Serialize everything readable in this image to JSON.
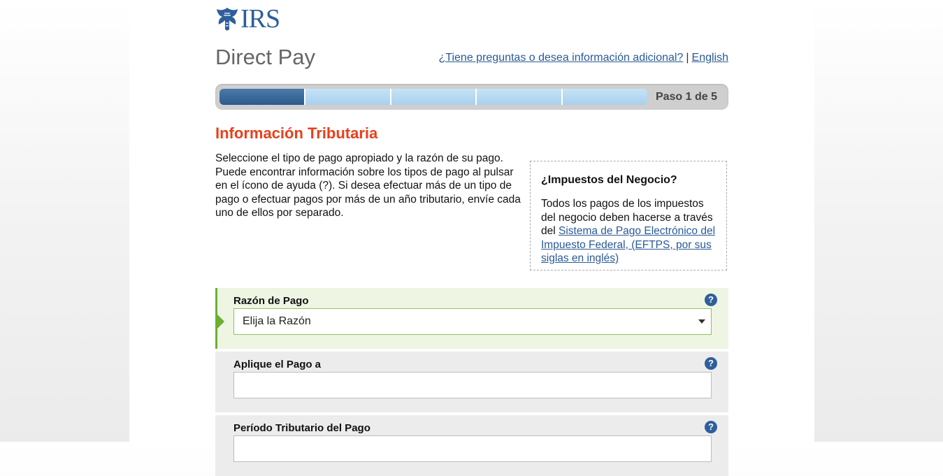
{
  "logo": {
    "text": "IRS"
  },
  "app": {
    "title": "Direct Pay"
  },
  "header": {
    "questions_link": "¿Tiene preguntas o desea información adicional?",
    "separator": "|",
    "language_link": "English"
  },
  "progress": {
    "label": "Paso 1 de 5",
    "current_step": 1,
    "total_steps": 5
  },
  "section": {
    "heading": "Información Tributaria",
    "intro": "Seleccione el tipo de pago apropiado y la razón de su pago. Puede encontrar información sobre los tipos de pago al pulsar en el ícono de ayuda (?). Si desea efectuar más de un tipo de pago o efectuar pagos por más de un año tributario, envíe cada uno de ellos por separado."
  },
  "business_box": {
    "heading": "¿Impuestos del Negocio?",
    "text_before": "Todos los pagos de los impuestos del negocio deben hacerse a través del ",
    "link": "Sistema de Pago Electrónico del Impuesto Federal, (EFTPS, por sus siglas en inglés)"
  },
  "form": {
    "help_icon": "?",
    "reason": {
      "label": "Razón de Pago",
      "value": "Elija la Razón"
    },
    "apply_to": {
      "label": "Aplique el Pago a",
      "value": ""
    },
    "period": {
      "label": "Período Tributario del Pago",
      "value": ""
    }
  },
  "colors": {
    "brand_blue": "#2f5f9b",
    "heading_red": "#e8401c",
    "active_green": "#6ab02e"
  }
}
